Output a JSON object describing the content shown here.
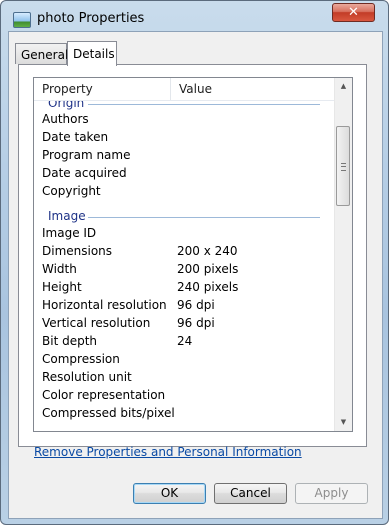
{
  "window": {
    "title": "photo Properties",
    "close_glyph": "✕"
  },
  "tabs": [
    {
      "label": "General",
      "active": false
    },
    {
      "label": "Details",
      "active": true
    }
  ],
  "details": {
    "columns": {
      "property": "Property",
      "value": "Value"
    },
    "groups": [
      {
        "label": "Origin",
        "rows": [
          {
            "property": "Authors",
            "value": ""
          },
          {
            "property": "Date taken",
            "value": ""
          },
          {
            "property": "Program name",
            "value": ""
          },
          {
            "property": "Date acquired",
            "value": ""
          },
          {
            "property": "Copyright",
            "value": ""
          }
        ]
      },
      {
        "label": "Image",
        "rows": [
          {
            "property": "Image ID",
            "value": ""
          },
          {
            "property": "Dimensions",
            "value": "200 x 240"
          },
          {
            "property": "Width",
            "value": "200 pixels"
          },
          {
            "property": "Height",
            "value": "240 pixels"
          },
          {
            "property": "Horizontal resolution",
            "value": "96 dpi"
          },
          {
            "property": "Vertical resolution",
            "value": "96 dpi"
          },
          {
            "property": "Bit depth",
            "value": "24"
          },
          {
            "property": "Compression",
            "value": ""
          },
          {
            "property": "Resolution unit",
            "value": ""
          },
          {
            "property": "Color representation",
            "value": ""
          },
          {
            "property": "Compressed bits/pixel",
            "value": ""
          }
        ]
      }
    ],
    "scrollbar": {
      "up_glyph": "▲",
      "down_glyph": "▼"
    }
  },
  "remove_link": "Remove Properties and Personal Information",
  "buttons": {
    "ok": "OK",
    "cancel": "Cancel",
    "apply": "Apply"
  },
  "colors": {
    "group_header": "#1e3287",
    "link": "#0a4aa4",
    "close_button": "#c23c27"
  }
}
